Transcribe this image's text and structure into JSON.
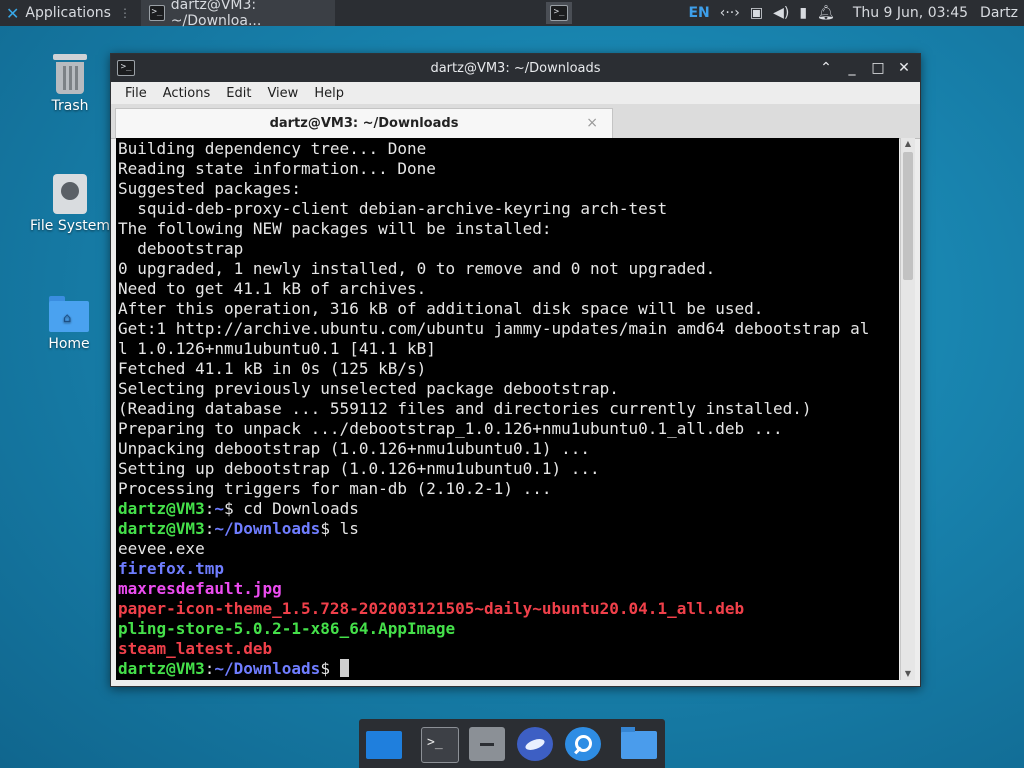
{
  "top_panel": {
    "applications_label": "Applications",
    "task_title": "dartz@VM3: ~/Downloa...",
    "language": "EN",
    "clock": "Thu  9 Jun, 03:45",
    "user": "Dartz",
    "tray_icons": [
      "network-icon",
      "display-icon",
      "volume-icon",
      "power-icon",
      "notifications-icon"
    ]
  },
  "desktop": {
    "icons": [
      {
        "label": "Trash",
        "icon": "trash-icon"
      },
      {
        "label": "File System",
        "icon": "disk-icon"
      },
      {
        "label": "Home",
        "icon": "home-folder-icon"
      }
    ]
  },
  "window": {
    "title": "dartz@VM3: ~/Downloads",
    "menu": [
      "File",
      "Actions",
      "Edit",
      "View",
      "Help"
    ],
    "tab_title": "dartz@VM3: ~/Downloads",
    "tab_close": "×"
  },
  "terminal": {
    "prompt_user": "dartz@VM3",
    "lines": [
      {
        "text": "Building dependency tree... Done"
      },
      {
        "text": "Reading state information... Done"
      },
      {
        "text": "Suggested packages:"
      },
      {
        "text": "  squid-deb-proxy-client debian-archive-keyring arch-test"
      },
      {
        "text": "The following NEW packages will be installed:"
      },
      {
        "text": "  debootstrap"
      },
      {
        "text": "0 upgraded, 1 newly installed, 0 to remove and 0 not upgraded."
      },
      {
        "text": "Need to get 41.1 kB of archives."
      },
      {
        "text": "After this operation, 316 kB of additional disk space will be used."
      },
      {
        "text": "Get:1 http://archive.ubuntu.com/ubuntu jammy-updates/main amd64 debootstrap al"
      },
      {
        "text": "l 1.0.126+nmu1ubuntu0.1 [41.1 kB]"
      },
      {
        "text": "Fetched 41.1 kB in 0s (125 kB/s)"
      },
      {
        "text": "Selecting previously unselected package debootstrap."
      },
      {
        "text": "(Reading database ... 559112 files and directories currently installed.)"
      },
      {
        "text": "Preparing to unpack .../debootstrap_1.0.126+nmu1ubuntu0.1_all.deb ..."
      },
      {
        "text": "Unpacking debootstrap (1.0.126+nmu1ubuntu0.1) ..."
      },
      {
        "text": "Setting up debootstrap (1.0.126+nmu1ubuntu0.1) ..."
      },
      {
        "text": "Processing triggers for man-db (2.10.2-1) ..."
      },
      {
        "prompt": "dartz@VM3",
        "path": "~",
        "cmd": "$ cd Downloads"
      },
      {
        "prompt": "dartz@VM3",
        "path": "~/Downloads",
        "cmd": "$ ls"
      },
      {
        "text": "eevee.exe",
        "color": "default"
      },
      {
        "text": "firefox.tmp",
        "color": "blue"
      },
      {
        "text": "maxresdefault.jpg",
        "color": "magenta"
      },
      {
        "text": "paper-icon-theme_1.5.728-202003121505~daily~ubuntu20.04.1_all.deb",
        "color": "red"
      },
      {
        "text": "pling-store-5.0.2-1-x86_64.AppImage",
        "color": "green"
      },
      {
        "text": "steam_latest.deb",
        "color": "red"
      },
      {
        "prompt": "dartz@VM3",
        "path": "~/Downloads",
        "cmd": "$ ",
        "cursor": true
      }
    ]
  },
  "colors": {
    "prompt_user": "#45e04a",
    "prompt_path": "#6f7dff",
    "exec_file": "#45e04a",
    "archive_file": "#f0404a",
    "image_file": "#ec4cf0",
    "tmp_file": "#6f7dff"
  },
  "dock": {
    "items": [
      "show-desktop-icon",
      "terminal-icon",
      "file-manager-icon",
      "web-browser-icon",
      "app-finder-icon",
      "home-folder-icon"
    ]
  }
}
